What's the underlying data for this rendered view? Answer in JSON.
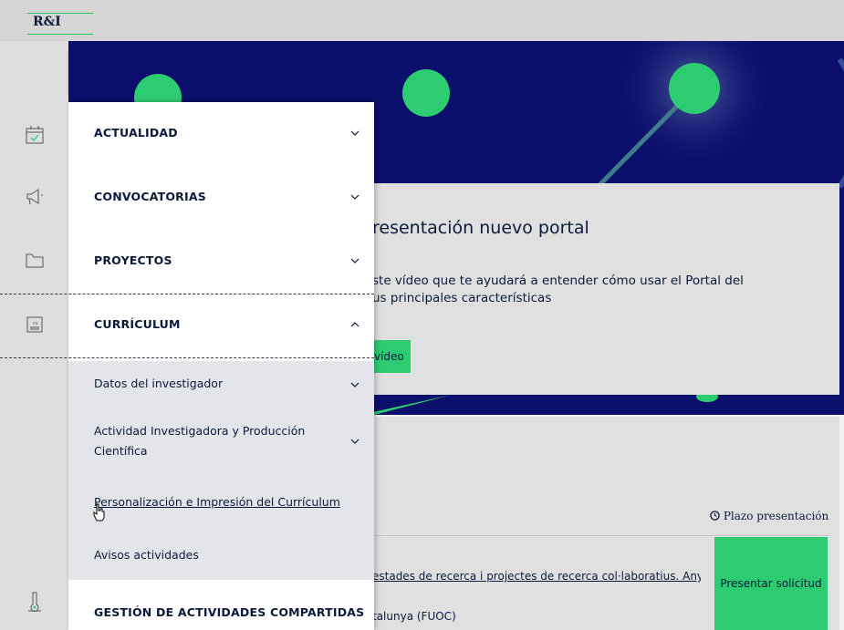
{
  "logo": {
    "text": "R&I"
  },
  "sidebar_icons": [
    "menu-icon",
    "calendar-icon",
    "megaphone-icon",
    "folder-icon",
    "cv-icon",
    "thermometer-icon"
  ],
  "card1": {
    "title": "resentación nuevo portal",
    "desc_line1": "ste vídeo que te ayudará a entender cómo usar el Portal del",
    "desc_line2": "us principales características",
    "video_button": "vídeo"
  },
  "card2": {
    "plazo_icon": "clock-icon",
    "plazo": "Plazo presentación",
    "line1": "estades de recerca i projectes de recerca col·laboratius. Any",
    "line2": "talunya (FUOC)",
    "present_button": "Presentar solicitud"
  },
  "menu": {
    "items": [
      {
        "label": "ACTUALIDAD"
      },
      {
        "label": "CONVOCATORIAS"
      },
      {
        "label": "PROYECTOS"
      },
      {
        "label": "CURRÍCULUM"
      }
    ],
    "submenu": [
      {
        "label": "Datos del investigador"
      },
      {
        "label_line1": "Actividad Investigadora y Producción",
        "label_line2": "Científica"
      },
      {
        "label": "Personalización e Impresión del Currículum"
      },
      {
        "label": "Avisos actividades"
      }
    ],
    "last_item": "GESTIÓN DE ACTIVIDADES COMPARTIDAS"
  },
  "colors": {
    "navy": "#0a0f6b",
    "green": "#2ecc71",
    "text": "#0b1a3b"
  }
}
